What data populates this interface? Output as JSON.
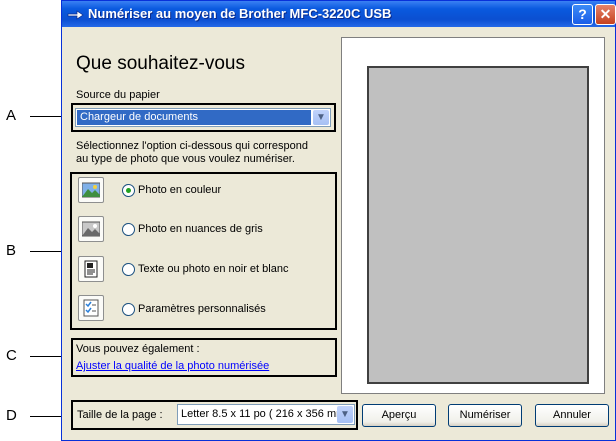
{
  "window": {
    "title": "Numériser au moyen de Brother MFC-3220C USB",
    "help_label": "?",
    "close_label": "✕"
  },
  "heading": "Que souhaitez-vous",
  "paper_source": {
    "label": "Source du papier",
    "selected": "Chargeur de documents"
  },
  "instructions": {
    "line1": "Sélectionnez l'option ci-dessous qui correspond",
    "line2": "au type de photo que vous voulez numériser."
  },
  "scan_options": [
    {
      "label": "Photo en couleur",
      "icon": "color-photo-icon",
      "selected": true
    },
    {
      "label": "Photo en nuances de gris",
      "icon": "grayscale-photo-icon",
      "selected": false
    },
    {
      "label": "Texte ou photo en noir et blanc",
      "icon": "bw-text-icon",
      "selected": false
    },
    {
      "label": "Paramètres personnalisés",
      "icon": "custom-settings-icon",
      "selected": false
    }
  ],
  "also": {
    "label": "Vous pouvez également :",
    "link": "Ajuster la qualité de la photo numérisée"
  },
  "page_size": {
    "label": "Taille de la page :",
    "selected": "Letter 8.5 x 11 po ( 216 x 356 mm"
  },
  "buttons": {
    "preview": "Aperçu",
    "scan": "Numériser",
    "cancel": "Annuler"
  },
  "callouts": [
    "A",
    "B",
    "C",
    "D"
  ],
  "colors": {
    "titlebar": "#0b4fd1",
    "dialog_bg": "#ece9d8",
    "selection": "#316ac5",
    "link": "#0000ff"
  }
}
